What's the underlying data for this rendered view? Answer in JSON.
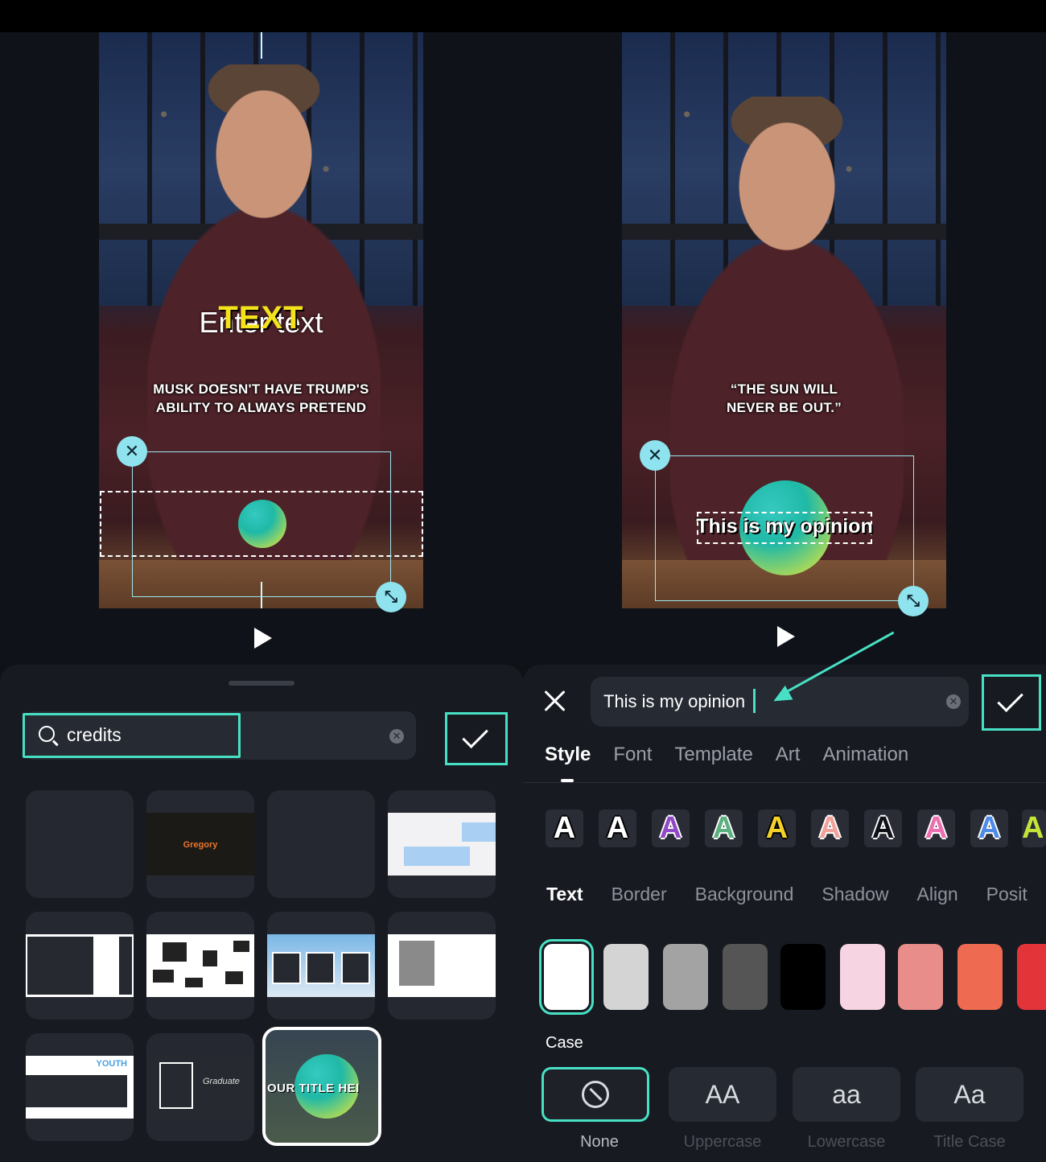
{
  "left_preview": {
    "text_effect_overlay": "TEXT",
    "text_placeholder": "Enter text",
    "caption_line1": "MUSK DOESN'T HAVE TRUMP'S",
    "caption_line2": "ABILITY TO ALWAYS PRETEND"
  },
  "right_preview": {
    "caption_line1": "“THE SUN WILL",
    "caption_line2": "NEVER BE OUT.”",
    "title_text": "This is my opinion"
  },
  "template_panel": {
    "search_value": "credits",
    "tiles": [
      {
        "label": ""
      },
      {
        "label": "Gregory"
      },
      {
        "label": ""
      },
      {
        "label": ""
      },
      {
        "label": ""
      },
      {
        "label": ""
      },
      {
        "label": ""
      },
      {
        "label": ""
      },
      {
        "label": "YOUTH"
      },
      {
        "label": "Graduate"
      },
      {
        "label": "OUR TITLE HEI"
      }
    ]
  },
  "text_panel": {
    "input_value": "This is my opinion",
    "tabs": [
      "Style",
      "Font",
      "Template",
      "Art",
      "Animation"
    ],
    "active_tab": "Style",
    "preset_glyph": "A",
    "subtabs": [
      "Text",
      "Border",
      "Background",
      "Shadow",
      "Align",
      "Posit"
    ],
    "active_subtab": "Text",
    "swatch_colors": [
      "#ffffff",
      "#d4d4d4",
      "#a3a3a3",
      "#555555",
      "#000000",
      "#f7d4e2",
      "#e88d8a",
      "#ee6a51",
      "#e3343a"
    ],
    "case_label": "Case",
    "case_options": [
      {
        "glyph": "⦸",
        "name": "None"
      },
      {
        "glyph": "AA",
        "name": "Uppercase"
      },
      {
        "glyph": "aa",
        "name": "Lowercase"
      },
      {
        "glyph": "Aa",
        "name": "Title Case"
      }
    ]
  },
  "colors": {
    "accent": "#48e0c4",
    "handle": "#8fe3ee",
    "panel": "#171a21"
  }
}
